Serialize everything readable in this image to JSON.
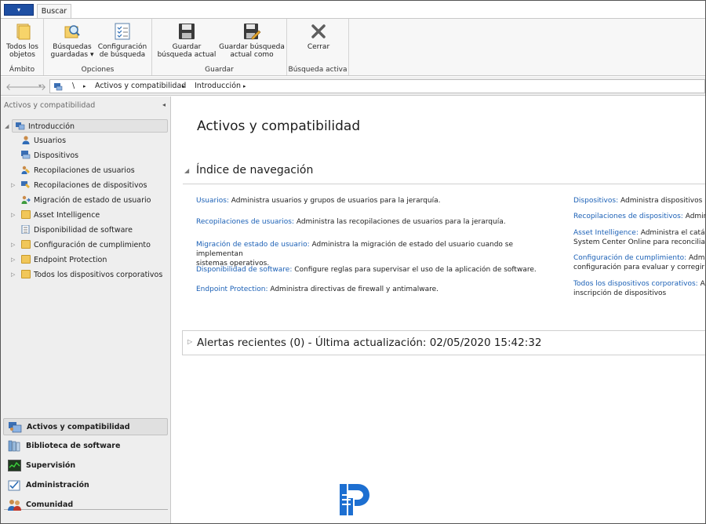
{
  "ribbon": {
    "tab": "Buscar",
    "groups": [
      {
        "label": "Ámbito",
        "buttons": [
          {
            "label_l1": "Todos los",
            "label_l2": "objetos"
          }
        ]
      },
      {
        "label": "Opciones",
        "buttons": [
          {
            "label_l1": "Búsquedas",
            "label_l2": "guardadas ▾"
          },
          {
            "label_l1": "Configuración",
            "label_l2": "de búsqueda"
          }
        ]
      },
      {
        "label": "Guardar",
        "buttons": [
          {
            "label_l1": "Guardar",
            "label_l2": "búsqueda actual"
          },
          {
            "label_l1": "Guardar búsqueda",
            "label_l2": "actual como"
          }
        ]
      },
      {
        "label": "Búsqueda activa",
        "buttons": [
          {
            "label_l1": "Cerrar",
            "label_l2": ""
          }
        ]
      }
    ]
  },
  "address": {
    "root": "\\",
    "crumbs": [
      "Activos y compatibilidad",
      "Introducción"
    ]
  },
  "left_pane": {
    "header": "Activos y compatibilidad",
    "tree": [
      "Introducción",
      "Usuarios",
      "Dispositivos",
      "Recopilaciones de usuarios",
      "Recopilaciones de dispositivos",
      "Migración de estado de usuario",
      "Asset Intelligence",
      "Disponibilidad de software",
      "Configuración de cumplimiento",
      "Endpoint Protection",
      "Todos los dispositivos corporativos"
    ],
    "workspaces": [
      "Activos y compatibilidad",
      "Biblioteca de software",
      "Supervisión",
      "Administración",
      "Comunidad"
    ]
  },
  "main": {
    "title": "Activos y compatibilidad",
    "section_title": "Índice de navegación",
    "left_column": [
      {
        "link": "Usuarios:",
        "text": " Administra usuarios y grupos de usuarios para la jerarquía."
      },
      {
        "link": "Recopilaciones de usuarios:",
        "text": " Administra las recopilaciones de usuarios para la jerarquía."
      },
      {
        "link": "Migración de estado de usuario:",
        "text": " Administra la migración de estado del usuario cuando se implementan",
        "text2": "sistemas operativos."
      },
      {
        "link": "Disponibilidad de software:",
        "text": " Configure reglas para supervisar el uso de la aplicación de software."
      },
      {
        "link": "Endpoint Protection:",
        "text": " Administra directivas de firewall y antimalware."
      }
    ],
    "right_column": [
      {
        "link": "Dispositivos:",
        "text": " Administra dispositivos par"
      },
      {
        "link": "Recopilaciones de dispositivos:",
        "text": " Adminis"
      },
      {
        "link": "Asset Intelligence:",
        "text": " Administra el catálog",
        "text2": "System Center Online para reconciliar las"
      },
      {
        "link": "Configuración de cumplimiento:",
        "text": " Admin",
        "text2": "configuración para evaluar y corregir la c"
      },
      {
        "link": "Todos los dispositivos corporativos:",
        "text": " Adr",
        "text2": "inscripción de dispositivos"
      }
    ],
    "alerts": "Alertas recientes (0) - Última actualización: 02/05/2020 15:42:32"
  },
  "colors": {
    "link": "#1b60b6",
    "accent": "#1e4fa3"
  }
}
